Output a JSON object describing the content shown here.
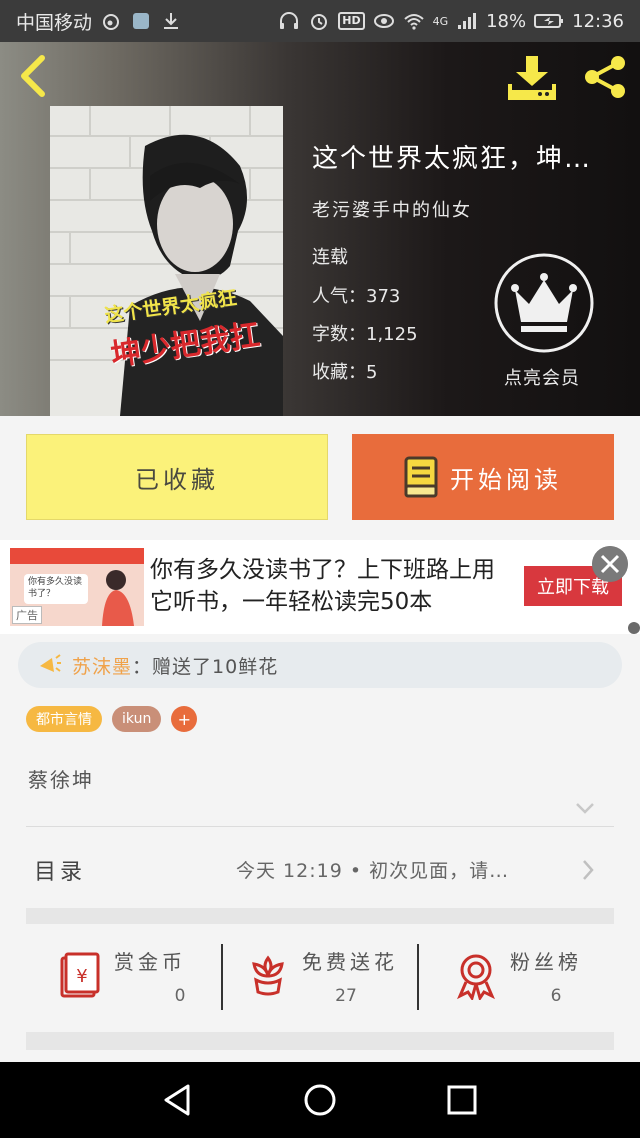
{
  "status_bar": {
    "carrier": "中国移动",
    "signal_type": "4G",
    "battery": "18%",
    "time": "12:36",
    "hd_label": "HD"
  },
  "book": {
    "title": "这个世界太疯狂，坤…",
    "author": "老污婆手中的仙女",
    "status": "连载",
    "popularity": "人气：373",
    "word_count": "字数：1,125",
    "favorites": "收藏：5",
    "cover_line1": "这个世界太疯狂",
    "cover_line2": "坤少把我扛"
  },
  "vip": {
    "label": "点亮会员"
  },
  "actions": {
    "collected_label": "已收藏",
    "read_label": "开始阅读"
  },
  "ad": {
    "text": "你有多久没读书了？上下班路上用它听书，一年轻松读完50本",
    "cta": "立即下载",
    "tag": "广告",
    "image_caption": "你有多久没读书了？"
  },
  "notice": {
    "user": "苏沫墨",
    "message": "：赠送了10鲜花"
  },
  "tags": [
    {
      "label": "都市言情",
      "color": "#f6b842"
    },
    {
      "label": "ikun",
      "color": "#c98f78"
    }
  ],
  "tag_add": "+",
  "intro": "蔡徐坤",
  "toc": {
    "label": "目录",
    "latest": "今天 12:19 • 初次见面，请…"
  },
  "stats": [
    {
      "label": "赏金币",
      "value": "0",
      "icon": "red-envelope-icon"
    },
    {
      "label": "免费送花",
      "value": "27",
      "icon": "flower-icon"
    },
    {
      "label": "粉丝榜",
      "value": "6",
      "icon": "medal-icon"
    }
  ],
  "colors": {
    "accent_orange": "#e86c3c",
    "collected_yellow": "#fbf27a",
    "icon_red": "#c8302a",
    "header_yellow": "#f6e84a"
  }
}
